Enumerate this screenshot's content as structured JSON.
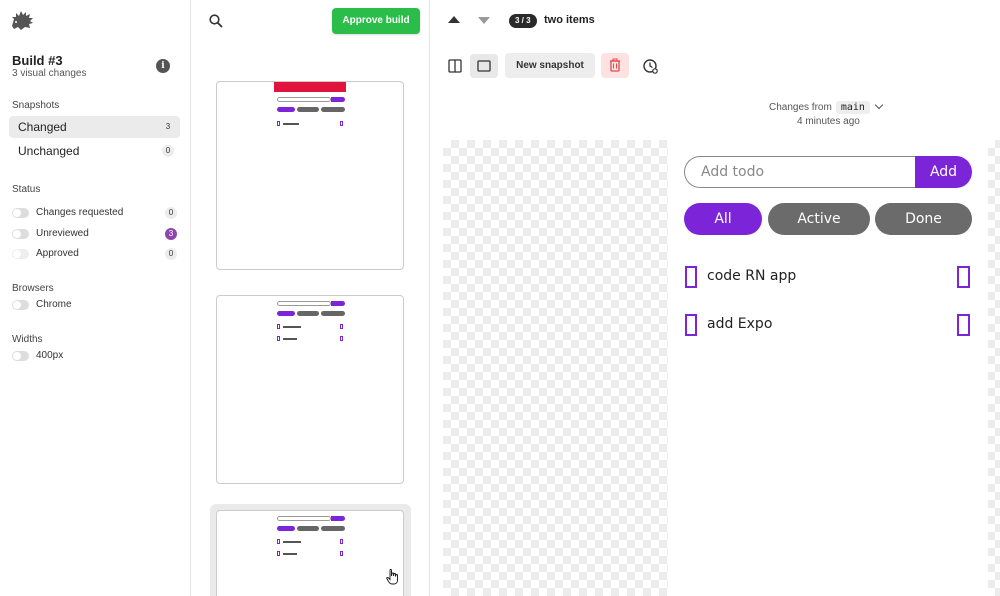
{
  "build": {
    "title": "Build #3",
    "subtitle": "3 visual changes",
    "info_icon": "info-icon"
  },
  "sidebar": {
    "snapshots_label": "Snapshots",
    "snapshots": [
      {
        "label": "Changed",
        "count": "3",
        "active": true
      },
      {
        "label": "Unchanged",
        "count": "0",
        "active": false
      }
    ],
    "status_label": "Status",
    "status": [
      {
        "label": "Changes requested",
        "count": "0"
      },
      {
        "label": "Unreviewed",
        "count": "3"
      },
      {
        "label": "Approved",
        "count": "0"
      }
    ],
    "browsers_label": "Browsers",
    "browsers": [
      {
        "label": "Chrome"
      }
    ],
    "widths_label": "Widths",
    "widths": [
      {
        "label": "400px"
      }
    ]
  },
  "middle": {
    "approve_label": "Approve build",
    "thumbnails": [
      {
        "name": "thumb-1",
        "selected": false
      },
      {
        "name": "thumb-2",
        "selected": false
      },
      {
        "name": "thumb-3",
        "selected": true
      }
    ]
  },
  "toolbar": {
    "pager": "3 / 3",
    "story_name": "two items",
    "new_snapshot_label": "New snapshot",
    "changes_from_label": "Changes from",
    "branch": "main",
    "time_ago": "4 minutes ago"
  },
  "preview": {
    "input_placeholder": "Add todo",
    "add_label": "Add",
    "filters": [
      {
        "label": "All",
        "active": true
      },
      {
        "label": "Active",
        "active": false
      },
      {
        "label": "Done",
        "active": false
      }
    ],
    "todos": [
      {
        "text": "code RN app"
      },
      {
        "text": "add Expo"
      }
    ]
  },
  "colors": {
    "approve_green": "#2bbd4a",
    "purple": "#7c25d8",
    "banner_red": "#e0143c"
  }
}
